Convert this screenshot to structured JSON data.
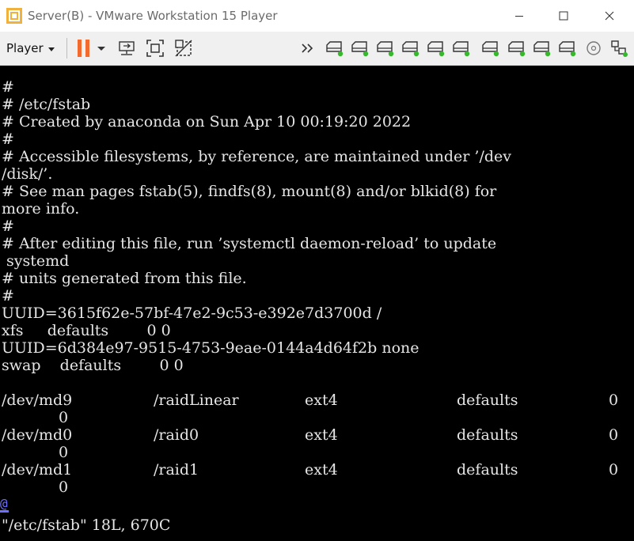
{
  "window": {
    "title": "Server(B) - VMware Workstation 15 Player",
    "controls": {
      "minimize": "—",
      "maximize": "☐",
      "close": "✕"
    }
  },
  "toolbar": {
    "player_label": "Player",
    "icons": [
      "pause-icon",
      "dropdown-caret-icon",
      "send-ctrl-alt-del-icon",
      "fit-guest-icon",
      "unity-icon",
      "more-devices-icon",
      "hard-disk-icon",
      "network-adapter-icon",
      "usb-icon",
      "sound-card-icon",
      "printer-icon",
      "display-icon",
      "message-log-icon"
    ]
  },
  "terminal": {
    "lines": [
      "#",
      "# /etc/fstab",
      "# Created by anaconda on Sun Apr 10 00:19:20 2022",
      "#",
      "# Accessible filesystems, by reference, are maintained under ’/dev",
      "/disk/’.",
      "# See man pages fstab(5), findfs(8), mount(8) and/or blkid(8) for",
      "more info.",
      "#",
      "# After editing this file, run ’systemctl daemon-reload’ to update",
      " systemd",
      "# units generated from this file.",
      "#",
      "UUID=3615f62e-57bf-47e2-9c53-e392e7d3700d /",
      "xfs     defaults        0 0",
      "UUID=6d384e97-9515-4753-9eae-0144a4d64f2b none",
      "swap    defaults        0 0"
    ],
    "fstab_rows": [
      {
        "device": "/dev/md9",
        "mount": "/raidLinear",
        "fstype": "ext4",
        "options": "defaults",
        "dump": "0",
        "pass": "0"
      },
      {
        "device": "/dev/md0",
        "mount": "/raid0",
        "fstype": "ext4",
        "options": "defaults",
        "dump": "0",
        "pass": "0"
      },
      {
        "device": "/dev/md1",
        "mount": "/raid1",
        "fstype": "ext4",
        "options": "defaults",
        "dump": "0",
        "pass": "0"
      }
    ],
    "cursor_char": "@",
    "status_line": "\"/etc/fstab\" 18L, 670C"
  },
  "colors": {
    "terminal_bg": "#000000",
    "terminal_fg": "#e6e6e6",
    "cursor": "#6f6fff",
    "pause_icon": "#f26a2e",
    "device_led": "#35b82a"
  }
}
